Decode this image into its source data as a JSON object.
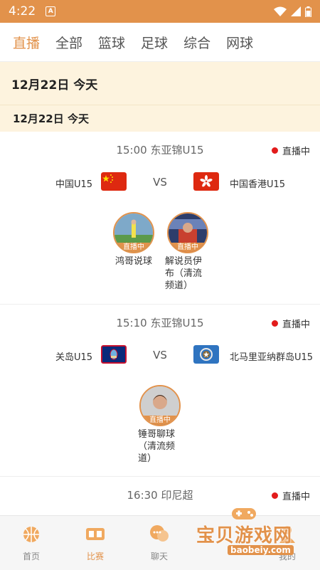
{
  "status_bar": {
    "time": "4:22",
    "notification_letter": "A"
  },
  "tabs": [
    {
      "label": "直播"
    },
    {
      "label": "全部"
    },
    {
      "label": "篮球"
    },
    {
      "label": "足球"
    },
    {
      "label": "综合"
    },
    {
      "label": "网球"
    }
  ],
  "date_header": "12月22日  今天",
  "date_subheader": "12月22日   今天",
  "matches": [
    {
      "time_league": "15:00  东亚锦U15",
      "status": "直播中",
      "home_team": "中国U15",
      "away_team": "中国香港U15",
      "vs": "VS",
      "streamers": [
        {
          "name": "鸿哥说球",
          "badge": "直播中"
        },
        {
          "name": "解说员伊布（清流频道）",
          "badge": "直播中"
        }
      ]
    },
    {
      "time_league": "15:10  东亚锦U15",
      "status": "直播中",
      "home_team": "关岛U15",
      "away_team": "北马里亚纳群岛U15",
      "vs": "VS",
      "streamers": [
        {
          "name": "锤哥聊球（清流频道）",
          "badge": "直播中"
        }
      ]
    },
    {
      "time_league": "16:30  印尼超",
      "status": "直播中"
    }
  ],
  "bottom_nav": [
    {
      "label": "首页",
      "icon": "home-basketball-icon"
    },
    {
      "label": "比赛",
      "icon": "scoreboard-icon"
    },
    {
      "label": "聊天",
      "icon": "chat-bubble-icon"
    },
    {
      "label": "我的",
      "icon": "profile-icon"
    }
  ],
  "watermark": {
    "text": "宝贝游戏网",
    "url": "baobeiy.com"
  },
  "colors": {
    "accent": "#e2924b",
    "live_dot": "#e21b1b",
    "date_bg": "#fdf3de"
  }
}
